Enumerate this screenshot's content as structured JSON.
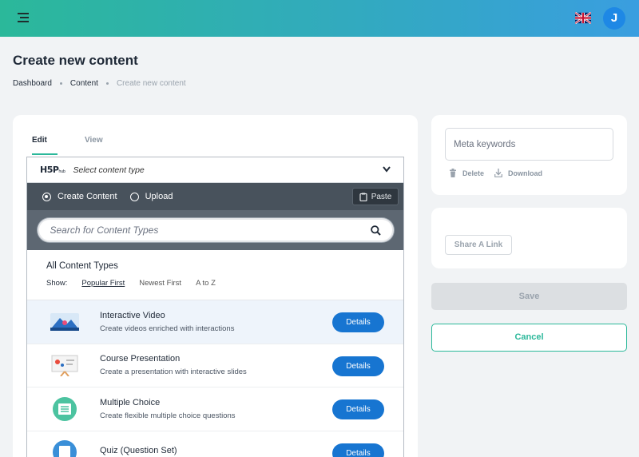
{
  "header": {
    "avatar_initial": "J",
    "brand_color": "#2bb89a",
    "language_flag": "uk-flag-icon"
  },
  "page": {
    "title": "Create new content"
  },
  "breadcrumb": [
    "Dashboard",
    "Content",
    "Create new content"
  ],
  "tabs": [
    {
      "label": "Edit",
      "active": true
    },
    {
      "label": "View",
      "active": false
    }
  ],
  "selector": {
    "logo_main": "H5P",
    "logo_sub": "hub",
    "placeholder": "Select content type",
    "modes": [
      {
        "label": "Create Content",
        "selected": true
      },
      {
        "label": "Upload",
        "selected": false
      }
    ],
    "paste_label": "Paste",
    "search_placeholder": "Search for Content Types",
    "types_title": "All Content Types",
    "show_label": "Show:",
    "sort_options": [
      {
        "label": "Popular First",
        "active": true
      },
      {
        "label": "Newest First",
        "active": false
      },
      {
        "label": "A to Z",
        "active": false
      }
    ],
    "details_label": "Details",
    "items": [
      {
        "title": "Interactive Video",
        "desc": "Create videos enriched with interactions",
        "icon": "interactive-video-icon"
      },
      {
        "title": "Course Presentation",
        "desc": "Create a presentation with interactive slides",
        "icon": "course-presentation-icon"
      },
      {
        "title": "Multiple Choice",
        "desc": "Create flexible multiple choice questions",
        "icon": "multiple-choice-icon"
      },
      {
        "title": "Quiz (Question Set)",
        "desc": "",
        "icon": "question-set-icon"
      }
    ]
  },
  "side": {
    "meta_placeholder": "Meta keywords",
    "delete_label": "Delete",
    "download_label": "Download",
    "share_label": "Share A Link",
    "save_label": "Save",
    "cancel_label": "Cancel"
  }
}
